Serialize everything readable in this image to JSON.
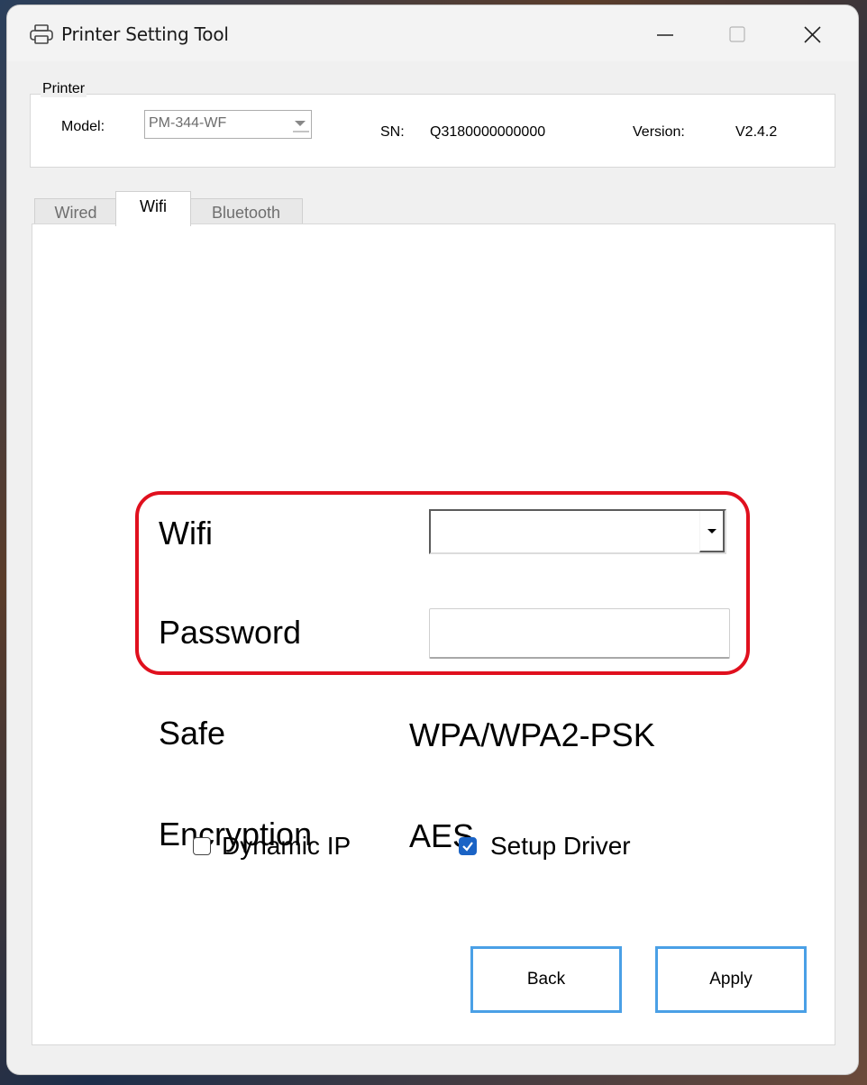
{
  "window": {
    "title": "Printer Setting Tool",
    "icons": {
      "app": "printer-icon",
      "minimize": "minimize-icon",
      "maximize": "maximize-icon",
      "close": "close-icon"
    }
  },
  "printer": {
    "legend": "Printer",
    "model_label": "Model:",
    "model_value": "PM-344-WF",
    "sn_label": "SN:",
    "sn_value": "Q3180000000000",
    "version_label": "Version:",
    "version_value": "V2.4.2"
  },
  "tabs": [
    {
      "label": "Wired",
      "active": false
    },
    {
      "label": "Wifi",
      "active": true
    },
    {
      "label": "Bluetooth",
      "active": false
    }
  ],
  "wifi_panel": {
    "wifi_label": "Wifi",
    "wifi_value": "",
    "password_label": "Password",
    "password_value": "",
    "safe_label": "Safe",
    "safe_value": "WPA/WPA2-PSK",
    "encryption_label": "Encryption",
    "encryption_value": "AES",
    "highlight_color": "#e0101e"
  },
  "options": {
    "dynamic_ip_label": "Dynamic IP",
    "dynamic_ip_checked": false,
    "setup_driver_label": "Setup Driver",
    "setup_driver_checked": true
  },
  "buttons": {
    "back_label": "Back",
    "apply_label": "Apply",
    "accent": "#4aa0e6"
  }
}
